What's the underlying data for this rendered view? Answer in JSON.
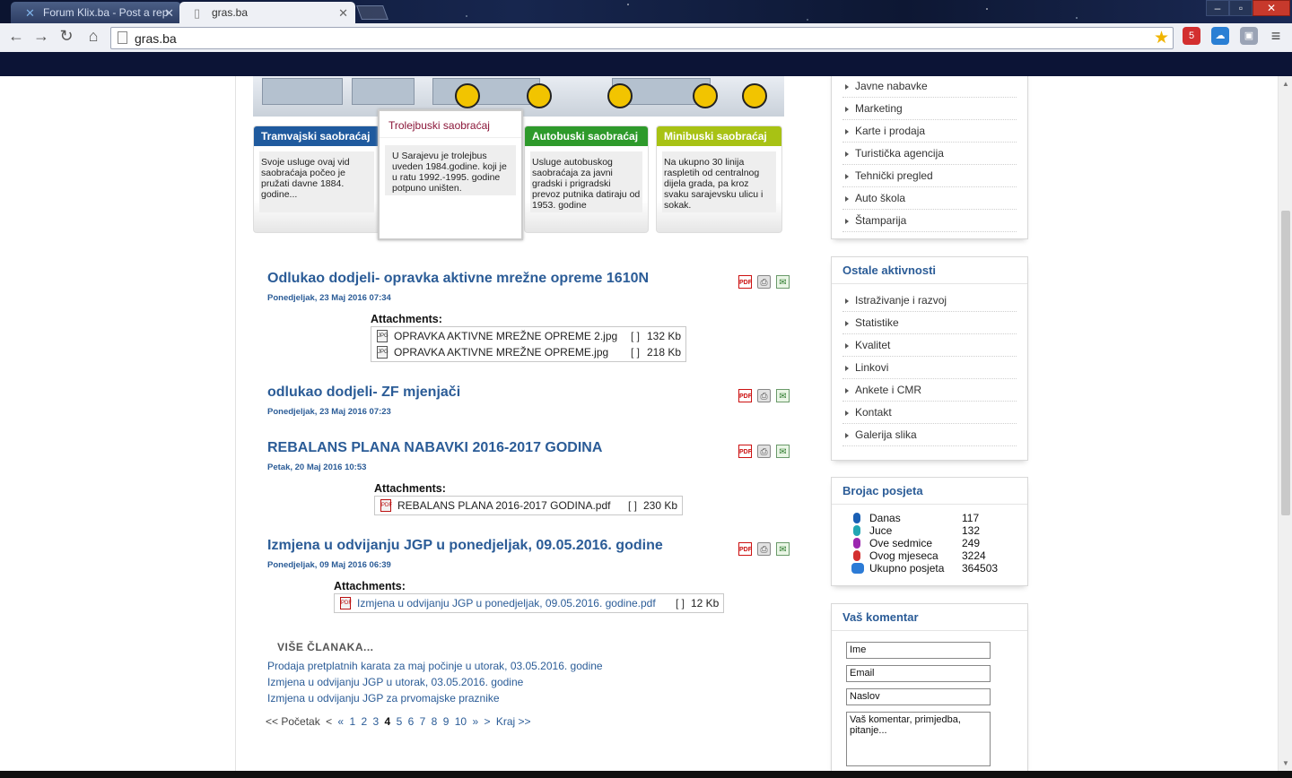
{
  "browser": {
    "tabs": [
      {
        "title": "Forum Klix.ba - Post a rep"
      },
      {
        "title": "gras.ba"
      }
    ],
    "url": "gras.ba",
    "ext_badge": "5"
  },
  "services": {
    "tram": {
      "title": "Tramvajski saobraćaj",
      "text": "Svoje usluge ovaj vid saobraćaja počeo je pružati davne 1884. godine..."
    },
    "troley": {
      "title": "Trolejbuski saobraćaj",
      "text": "U Sarajevu je trolejbus uveden 1984.godine. koji je u ratu 1992.-1995. godine potpuno uništen."
    },
    "bus": {
      "title": "Autobuski saobraćaj",
      "text": "Usluge autobuskog saobraćaja za javni gradski i prigradski prevoz putnika datiraju od 1953. godine"
    },
    "mini": {
      "title": "Minibuski saobraćaj",
      "text": "Na ukupno 30 linija raspletih od centralnog dijela grada, pa kroz svaku sarajevsku ulicu i sokak."
    }
  },
  "articles": [
    {
      "title": "Odlukao dodjeli- opravka aktivne mrežne opreme 1610N",
      "date": "Ponedjeljak, 23 Maj 2016 07:34",
      "attachments_label": "Attachments:",
      "attachments": [
        {
          "name": "OPRAVKA AKTIVNE MREŽNE OPREME 2.jpg",
          "br": "[ ]",
          "size": "132 Kb"
        },
        {
          "name": "OPRAVKA AKTIVNE MREŽNE OPREME.jpg",
          "br": "[ ]",
          "size": "218 Kb"
        }
      ]
    },
    {
      "title": "odlukao dodjeli- ZF mjenjači",
      "date": "Ponedjeljak, 23 Maj 2016 07:23"
    },
    {
      "title": "REBALANS PLANA NABAVKI 2016-2017 GODINA",
      "date": "Petak, 20 Maj 2016 10:53",
      "attachments_label": "Attachments:",
      "attachments": [
        {
          "name": "REBALANS PLANA 2016-2017 GODINA.pdf",
          "br": "[ ]",
          "size": "230 Kb"
        }
      ]
    },
    {
      "title": "Izmjena u odvijanju JGP u ponedjeljak, 09.05.2016. godine",
      "date": "Ponedjeljak, 09 Maj 2016 06:39",
      "attachments_label": "Attachments:",
      "attachments": [
        {
          "name": "Izmjena u odvijanju JGP u ponedjeljak, 09.05.2016. godine.pdf",
          "br": "[ ]",
          "size": "12 Kb"
        }
      ]
    }
  ],
  "more": {
    "heading": "VIŠE ČLANAKA...",
    "links": [
      "Prodaja pretplatnih karata za maj počinje u utorak, 03.05.2016. godine",
      "Izmjena u odvijanju JGP u utorak, 03.05.2016. godine",
      "Izmjena u odvijanju JGP za prvomajske praznike"
    ]
  },
  "pager": {
    "first": "<< Početak",
    "prev_a": "<",
    "prev_b": "«",
    "pages": [
      "1",
      "2",
      "3",
      "4",
      "5",
      "6",
      "7",
      "8",
      "9",
      "10"
    ],
    "current": "4",
    "next_a": "»",
    "next_b": ">",
    "last": "Kraj >>"
  },
  "menu_top": [
    "Javne nabavke",
    "Marketing",
    "Karte i prodaja",
    "Turistička agencija",
    "Tehnički pregled",
    "Auto škola",
    "Štamparija"
  ],
  "other": {
    "title": "Ostale aktivnosti",
    "items": [
      "Istraživanje i razvoj",
      "Statistike",
      "Kvalitet",
      "Linkovi",
      "Ankete i CMR",
      "Kontakt",
      "Galerija slika"
    ]
  },
  "counter": {
    "title": "Brojac posjeta",
    "rows": [
      {
        "label": "Danas",
        "value": "117",
        "color": "#1a5fb4"
      },
      {
        "label": "Juce",
        "value": "132",
        "color": "#22a6b3"
      },
      {
        "label": "Ove sedmice",
        "value": "249",
        "color": "#9b27b0"
      },
      {
        "label": "Ovog mjeseca",
        "value": "3224",
        "color": "#d32f2f"
      },
      {
        "label": "Ukupno posjeta",
        "value": "364503",
        "color": "#2c7bd6"
      }
    ]
  },
  "comment": {
    "title": "Vaš komentar",
    "name": "Ime",
    "email": "Email",
    "subject": "Naslov",
    "message": "Vaš komentar, primjedba, pitanje..."
  }
}
